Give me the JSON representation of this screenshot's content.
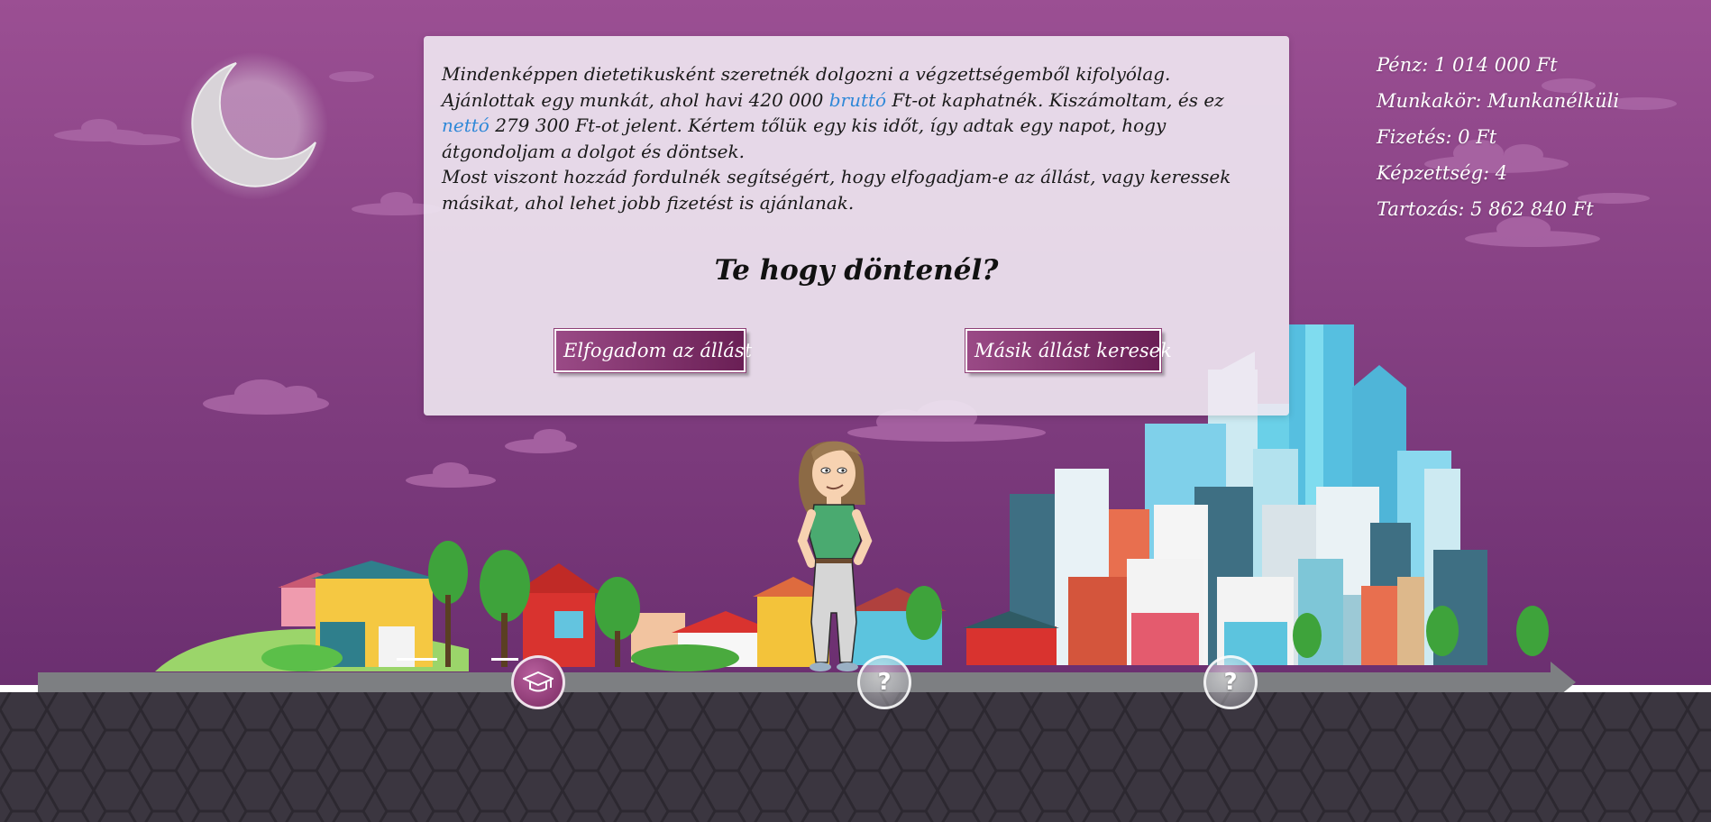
{
  "stats": {
    "money": "Pénz: 1 014 000 Ft",
    "job": "Munkakör: Munkanélküli",
    "salary": "Fizetés: 0 Ft",
    "education": "Képzettség: 4",
    "debt": "Tartozás: 5 862 840 Ft"
  },
  "story": {
    "line1": "Mindenképpen dietetikusként szeretnék dolgozni a végzettségemből kifolyólag.",
    "line2_a": "Ajánlottak egy munkát, ahol havi 420 000 ",
    "line2_link": "bruttó",
    "line2_b": " Ft-ot kaphatnék. Kiszámoltam, és ez",
    "line3_link": "nettó",
    "line3_b": " 279 300 Ft-ot jelent. Kértem tőlük egy kis időt, így adtak egy napot, hogy",
    "line4": "átgondoljam a dolgot és döntsek.",
    "line5": "Most viszont hozzád fordulnék segítségért, hogy elfogadjam-e az állást, vagy keressek",
    "line6": "másikat, ahol lehet jobb fizetést is ajánlanak."
  },
  "question": "Te hogy döntenél?",
  "buttons": {
    "accept": "Elfogadom az állást",
    "other": "Másik állást keresek"
  },
  "timeline": {
    "unknown_label": "?",
    "icons": [
      "graduation-cap-icon",
      "question-mark-icon",
      "question-mark-icon"
    ]
  },
  "colors": {
    "sky_top": "#9b4f93",
    "sky_bottom": "#6a2f6f",
    "ground": "#3b3640",
    "button": "#7c2e66",
    "link": "#2f88d8"
  }
}
